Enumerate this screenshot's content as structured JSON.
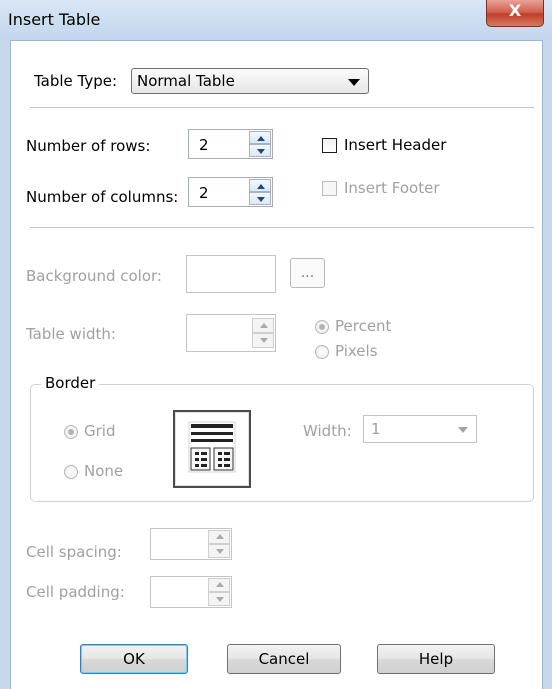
{
  "window": {
    "title": "Insert Table",
    "close_glyph": "X"
  },
  "table_type": {
    "label": "Table Type:",
    "selected": "Normal Table"
  },
  "rows": {
    "label": "Number of rows:",
    "value": "2"
  },
  "columns": {
    "label": "Number of columns:",
    "value": "2"
  },
  "insert_header": {
    "label": "Insert Header",
    "checked": false
  },
  "insert_footer": {
    "label": "Insert Footer",
    "checked": false,
    "enabled": false
  },
  "background_color": {
    "label": "Background color:",
    "button_label": "..."
  },
  "table_width": {
    "label": "Table width:",
    "value": "",
    "options": [
      {
        "label": "Percent",
        "selected": true
      },
      {
        "label": "Pixels",
        "selected": false
      }
    ]
  },
  "border": {
    "group_label": "Border",
    "options": [
      {
        "label": "Grid",
        "selected": true
      },
      {
        "label": "None",
        "selected": false
      }
    ],
    "width_label": "Width:",
    "width_value": "1"
  },
  "cell_spacing": {
    "label": "Cell spacing:",
    "value": ""
  },
  "cell_padding": {
    "label": "Cell padding:",
    "value": ""
  },
  "buttons": {
    "ok": "OK",
    "cancel": "Cancel",
    "help": "Help"
  },
  "colors": {
    "disabled_text": "#a0a0a0",
    "title_bar": "#cfdff1",
    "close_button": "#c1402c"
  }
}
